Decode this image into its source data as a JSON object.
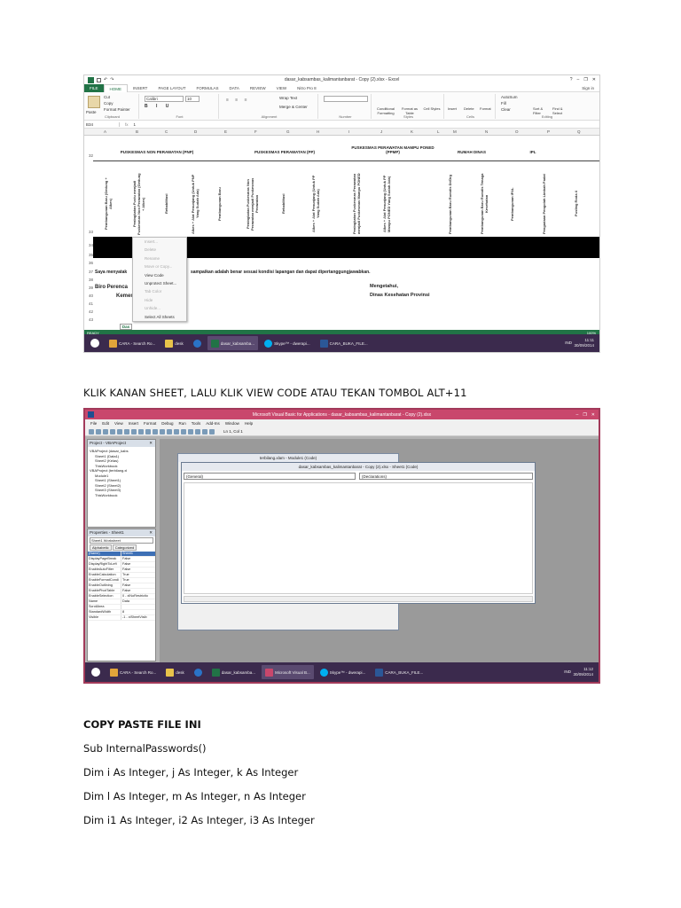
{
  "shot1": {
    "window_title": "dasar_kabsambas_kalimantanbarat - Copy (2).xlsx - Excel",
    "sign_in": "Sign in",
    "tabs": [
      "FILE",
      "HOME",
      "INSERT",
      "PAGE LAYOUT",
      "FORMULAS",
      "DATA",
      "REVIEW",
      "VIEW",
      "Nitro Pro 8"
    ],
    "clipboard": {
      "paste": "Paste",
      "cut": "Cut",
      "copy": "Copy",
      "format_painter": "Format Painter",
      "label": "Clipboard"
    },
    "font": {
      "name": "Calibri",
      "size": "10",
      "label": "Font"
    },
    "alignment": {
      "wrap": "Wrap Text",
      "merge": "Merge & Center",
      "label": "Alignment"
    },
    "number_label": "Number",
    "styles": {
      "cond": "Conditional Formatting",
      "table": "Format as Table",
      "cell": "Cell Styles",
      "label": "Styles"
    },
    "cells": {
      "insert": "Insert",
      "delete": "Delete",
      "format": "Format",
      "label": "Cells"
    },
    "editing": {
      "autosum": "AutoSum",
      "fill": "Fill",
      "clear": "Clear",
      "sort": "Sort & Filter",
      "find": "Find & Select",
      "label": "Editing"
    },
    "name_box": "B34",
    "formula_value": "1",
    "columns": [
      "A",
      "B",
      "C",
      "D",
      "E",
      "F",
      "G",
      "H",
      "I",
      "J",
      "K",
      "L",
      "M",
      "N",
      "O",
      "P",
      "Q"
    ],
    "sections": [
      "PUSKESMAS NON PERAWATAN (PNP)",
      "PUSKESMAS PERAWATAN (PP)",
      "PUSKESMAS PERAWATAN MAMPU PONED (PPMP)",
      "RUMAH DINAS",
      "IPL"
    ],
    "vertical_headers": [
      "Pembangunan Baru (Gedung + Alkes)",
      "Peningkatan Pustu menjadi Puskesmas Non Perawatan (Gedung + Alkes)",
      "Rehabilitasi",
      "Alkes + Alat Penunjang (Untuk PNP Yang Sudah Ada)",
      "Pembangunan Baru",
      "Peningkatan Puskesmas Non Perawatan menjadi Puskesmas Perawatan",
      "Rehabilitasi",
      "Alkes + Alat Penunjang (Untuk PP Yang Sudah Ada)",
      "Peningkatan Puskesmas Perawatan menjadi Puskesmas Mampu PONED",
      "Alkes + Alat Penunjang (Untuk PP Mampu PONED Yang Sudah Ada)",
      "Pembangunan Baru Rumdis Dr/Drg",
      "Pembangunan Baru Rumdis Tenaga Kesehatan",
      "Pembangunan IPAL",
      "Pengadaan Pengolah Limbah Padat",
      "Pusling Roda 4"
    ],
    "row_numbers": [
      "32",
      "33",
      "34",
      "35",
      "36",
      "37",
      "38",
      "39",
      "40",
      "41",
      "42",
      "43"
    ],
    "context_menu": [
      {
        "label": "Insert...",
        "disabled": true
      },
      {
        "label": "Delete",
        "disabled": true
      },
      {
        "label": "Rename",
        "disabled": true
      },
      {
        "label": "Move or Copy...",
        "disabled": true
      },
      {
        "label": "View Code",
        "disabled": false
      },
      {
        "label": "Unprotect Sheet...",
        "disabled": false
      },
      {
        "label": "Tab Color",
        "disabled": true
      },
      {
        "label": "Hide",
        "disabled": true
      },
      {
        "label": "Unhide...",
        "disabled": true
      },
      {
        "label": "Select All Sheets",
        "disabled": false
      }
    ],
    "statement_left": "Saya menyatak",
    "statement_right": "sampaikan adalah benar sesuai kondisi lapangan dan dapat dipertanggungjawabkan.",
    "biro": "Biro Perenca",
    "kemen": "Kemen",
    "mengetahui": "Mengetahui,",
    "dinas": "Dinas Kesehatan Provinsi",
    "sheet_tab": "Das",
    "status": "READY",
    "zoom": "100%",
    "taskbar": [
      "CARA - Search Ro...",
      "desk",
      "dasar_kabsamba...",
      "Skype™ - dwerapi...",
      "CARA_BUKA_FILE..."
    ],
    "time": "11:11",
    "date": "30/09/2014",
    "lang": "IND"
  },
  "caption1": "KLIK KANAN SHEET, LALU KLIK VIEW CODE ATAU TEKAN TOMBOL ALT+11",
  "shot2": {
    "window_title": "Microsoft Visual Basic for Applications - dasar_kabsambas_kalimantanbarat - Copy (2).xlsx",
    "menu": [
      "File",
      "Edit",
      "View",
      "Insert",
      "Format",
      "Debug",
      "Run",
      "Tools",
      "Add-Ins",
      "Window",
      "Help"
    ],
    "position": "Ln 1, Col 1",
    "project_title": "Project - VBAProject",
    "tree": [
      "VBAProject (dasar_kabs",
      "Sheet1 (Data1)",
      "Sheet2 (Kelas)",
      "ThisWorkbook",
      "VBAProject (terbilang.xl",
      "Module1",
      "Sheet1 (Sheet1)",
      "Sheet2 (Sheet2)",
      "Sheet3 (Sheet3)",
      "ThisWorkbook"
    ],
    "props_title": "Properties - Sheet1",
    "props_object": "Sheet1 Worksheet",
    "props_tabs": [
      "Alphabetic",
      "Categorized"
    ],
    "props": [
      [
        "(Name)",
        "Sheet1"
      ],
      [
        "DisplayPageBreak",
        "False"
      ],
      [
        "DisplayRightToLeft",
        "False"
      ],
      [
        "EnableAutoFilter",
        "False"
      ],
      [
        "EnableCalculation",
        "True"
      ],
      [
        "EnableFormatCondi",
        "True"
      ],
      [
        "EnableOutlining",
        "False"
      ],
      [
        "EnablePivotTable",
        "False"
      ],
      [
        "EnableSelection",
        "0 - xlNoRestrictio"
      ],
      [
        "Name",
        "Data"
      ],
      [
        "ScrollArea",
        ""
      ],
      [
        "StandardWidth",
        "8"
      ],
      [
        "Visible",
        "-1 - xlSheetVisib"
      ]
    ],
    "back_window": "terbilang.xlam - Module1 (Code)",
    "front_window": "dasar_kabsambas_kalimantanbarat - Copy (2).xlsx - Sheet1 (Code)",
    "combo_left": "(General)",
    "combo_right": "(Declarations)",
    "taskbar": [
      "CARA - Search Ro...",
      "desk",
      "dasar_kabsamba...",
      "Microsoft Visual B...",
      "Skype™ - dwerapi...",
      "CARA_BUKA_FILE..."
    ],
    "time": "11:12",
    "date": "30/09/2014",
    "lang": "IND"
  },
  "caption2": "COPY PASTE FILE INI",
  "code": [
    "Sub InternalPasswords()",
    "Dim i As Integer, j As Integer, k As Integer",
    "Dim l As Integer, m As Integer, n As Integer",
    "Dim i1 As Integer, i2 As Integer, i3 As Integer"
  ],
  "colors": {
    "excel_green": "#217346",
    "vba_title": "#c9476c",
    "taskbar": "#3b2a4d"
  }
}
